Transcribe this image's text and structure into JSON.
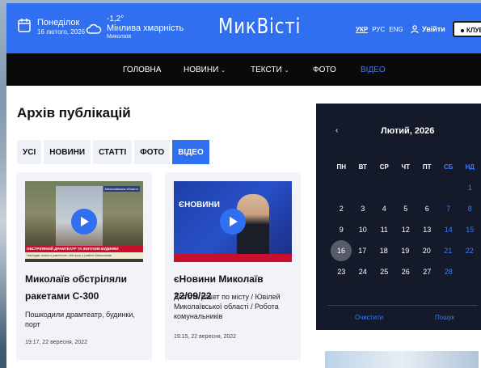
{
  "header": {
    "day": "Понеділок",
    "date": "16 лютого, 2026",
    "temp": "-1,2°",
    "weather": "Мінлива хмарність",
    "city": "Миколаїв",
    "logo": "МикВісті",
    "langs": [
      "УКР",
      "РУС",
      "ENG"
    ],
    "login": "Увійти",
    "club": "КЛУБ"
  },
  "nav": {
    "items": [
      "ГОЛОВНА",
      "НОВИНИ",
      "ТЕКСТИ",
      "ФОТО",
      "ВІДЕО"
    ],
    "active": "ВІДЕО"
  },
  "main": {
    "title": "Архів публікацій",
    "filters": [
      "УСІ",
      "НОВИНИ",
      "СТАТТІ",
      "ФОТО",
      "ВІДЕО"
    ],
    "active_filter": "ВІДЕО",
    "cards": [
      {
        "title": "Миколаїв обстріляли ракетами С-300",
        "subtitle": "Пошкодили драмтеатр, будинки, порт",
        "time": "19:17, 22 вересня, 2022",
        "thumb_caption": "ОБСТРІЛЯНИЙ ДРАМТЕАТР ТА ЖИТЛОВІ БУДИНКИ",
        "thumb_subcaption": "Наслідки нічного ракетного обстрілу у районі Миколаєва",
        "thumb_corner": "Миколаївська область"
      },
      {
        "title": "єНовини Миколаїв 22/09/22",
        "subtitle": "Дев'ять ракет по місту / Ювілей Миколаївської області / Робота комунальників",
        "time": "19:15, 22 вересня, 2022",
        "thumb_caption": "ЄНОВИНИ"
      }
    ]
  },
  "calendar": {
    "prev": "‹",
    "month": "Лютий, 2026",
    "weekdays": [
      "ПН",
      "ВТ",
      "СР",
      "ЧТ",
      "ПТ",
      "СБ",
      "НД"
    ],
    "weeks": [
      [
        "",
        "",
        "",
        "",
        "",
        "",
        "1"
      ],
      [
        "2",
        "3",
        "4",
        "5",
        "6",
        "7",
        "8"
      ],
      [
        "9",
        "10",
        "11",
        "12",
        "13",
        "14",
        "15"
      ],
      [
        "16",
        "17",
        "18",
        "19",
        "20",
        "21",
        "22"
      ],
      [
        "23",
        "24",
        "25",
        "26",
        "27",
        "28",
        ""
      ]
    ],
    "today": "16",
    "clear": "Очистити",
    "search": "Пошук"
  }
}
